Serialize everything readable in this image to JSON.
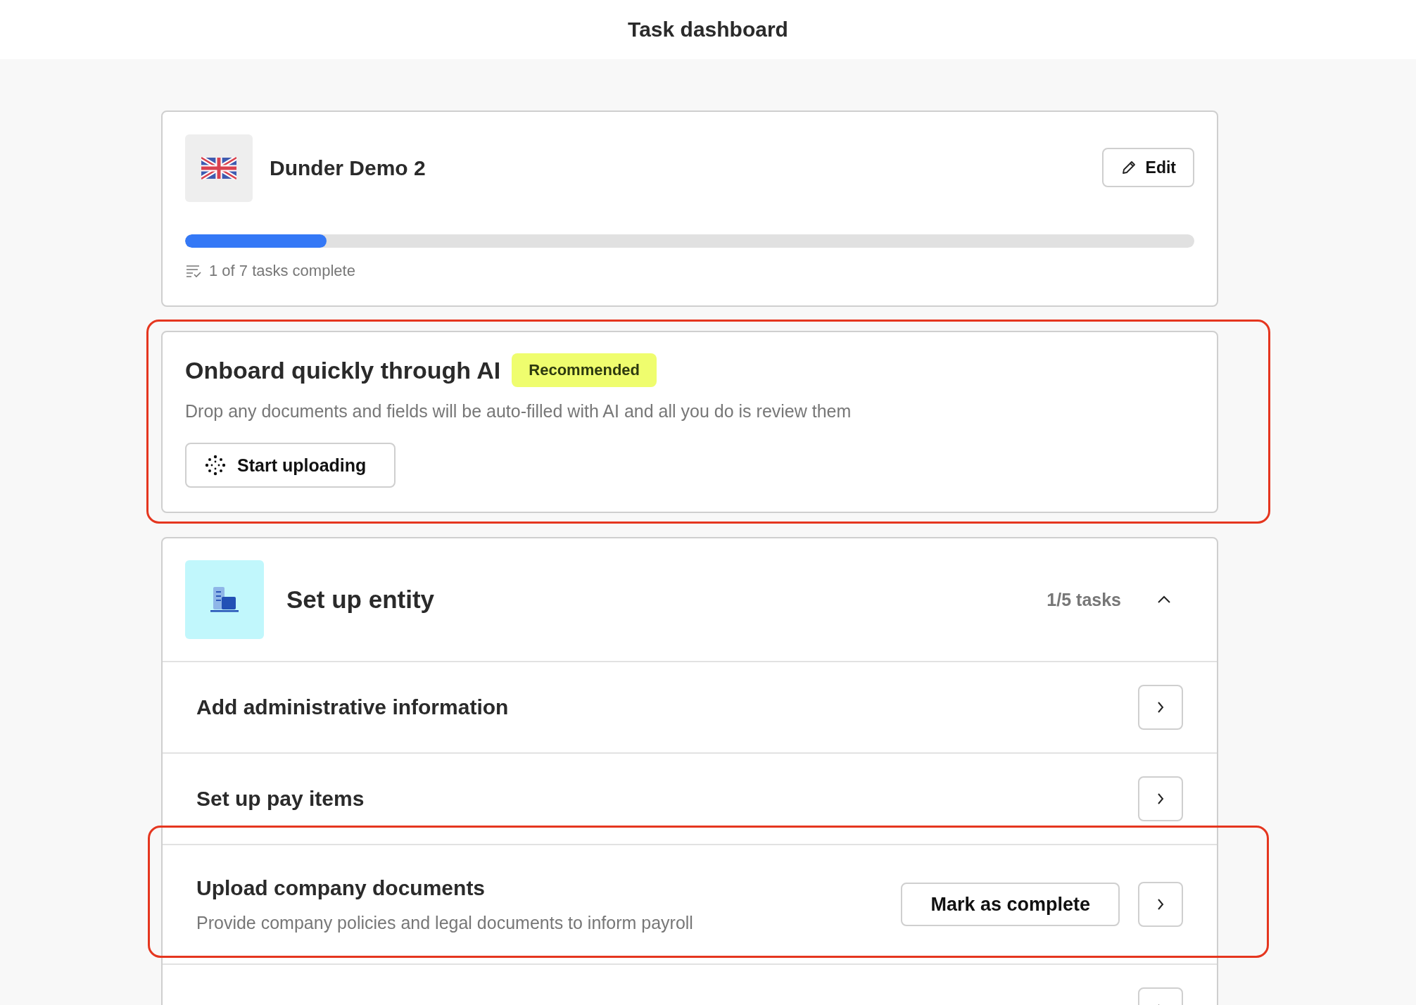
{
  "header": {
    "title": "Task dashboard"
  },
  "company": {
    "name": "Dunder Demo 2",
    "edit_button": "Edit",
    "progress": {
      "level": 0.14,
      "caption": "1 of 7 tasks complete"
    }
  },
  "ai_card": {
    "title": "Onboard quickly through AI",
    "badge": "Recommended",
    "description": "Drop any documents and fields will be auto-filled with AI and all you do is review them",
    "button": "Start uploading",
    "highlighted": true
  },
  "section": {
    "title": "Set up entity",
    "count": "1/5 tasks",
    "expanded": true,
    "tasks": [
      {
        "title": "Add administrative information",
        "highlighted": false
      },
      {
        "title": "Set up pay items",
        "highlighted": false
      },
      {
        "title": "Upload company documents",
        "description": "Provide company policies and legal documents to inform payroll",
        "action": "Mark as complete",
        "highlighted": true
      },
      {
        "highlighted": false
      }
    ]
  }
}
